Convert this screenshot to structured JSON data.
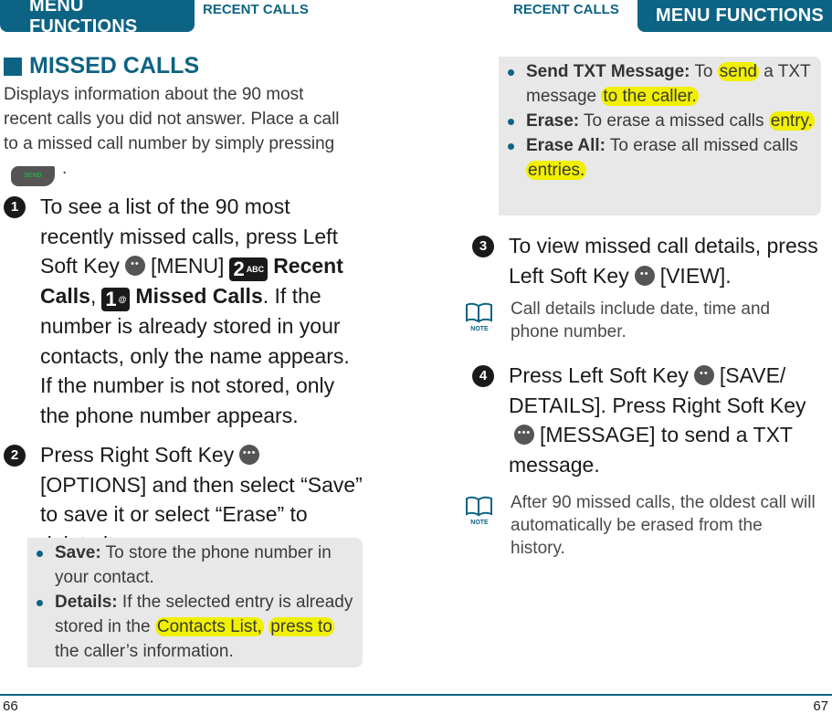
{
  "header": {
    "left_tab": "MENU FUNCTIONS",
    "left_section": "RECENT CALLS",
    "right_section": "RECENT CALLS",
    "right_tab": "MENU FUNCTIONS",
    "accent_color": "#0d6383"
  },
  "left_page": {
    "heading": "MISSED CALLS",
    "intro": {
      "text_before": "Displays information about the 90 most recent calls you did not answer. Place a call to a missed call number by simply pressing",
      "key_label": "SEND",
      "text_after": "."
    },
    "steps": [
      {
        "number": "1",
        "parts": {
          "a": "To see a list of the 90 most recently missed calls, press Left Soft Key",
          "b": "[MENU]",
          "key2_num": "2",
          "key2_sub": "ABC",
          "c": "Recent Calls",
          "d": ",",
          "key1_num": "1",
          "key1_sub": "@",
          "e": "Missed Calls",
          "f": ". If the number is already stored in your contacts, only the name appears. If the number is not stored, only the phone number appears."
        }
      },
      {
        "number": "2",
        "parts": {
          "a": "Press Right Soft Key",
          "b": "[OPTIONS] and then select “Save” to save it or select “Erase” to delete it."
        }
      }
    ],
    "options_box": [
      {
        "term": "Save:",
        "text": " To store the phone number in your contact."
      },
      {
        "term": "Details:",
        "text": " If the selected entry is already stored in the ",
        "highlight1": "Contacts List,",
        "text2": " ",
        "highlight2": "press to",
        "text3": " the caller’s information."
      }
    ],
    "page_number": "66"
  },
  "right_page": {
    "options_box": [
      {
        "term": "Send TXT Message:",
        "text": " To ",
        "highlight1": "send",
        "text2": " a TXT message ",
        "highlight2": "to the caller."
      },
      {
        "term": "Erase:",
        "text": " To erase a missed calls ",
        "highlight1": "entry."
      },
      {
        "term": "Erase All:",
        "text": " To erase all missed calls ",
        "highlight1": "entries."
      }
    ],
    "steps": [
      {
        "number": "3",
        "a": "To view missed call details, press Left Soft Key",
        "b": "[VIEW]."
      },
      {
        "number": "4",
        "a": "Press Left Soft Key",
        "b": "[SAVE/ DETAILS]. Press Right Soft Key",
        "c": "[MESSAGE] to send a TXT message."
      }
    ],
    "notes": [
      {
        "icon": "note-book-icon",
        "label": "NOTE",
        "text": "Call details include date, time and phone number."
      },
      {
        "icon": "note-book-icon",
        "label": "NOTE",
        "text": "After 90 missed calls, the oldest call will automatically be erased from the history."
      }
    ],
    "page_number": "67"
  }
}
